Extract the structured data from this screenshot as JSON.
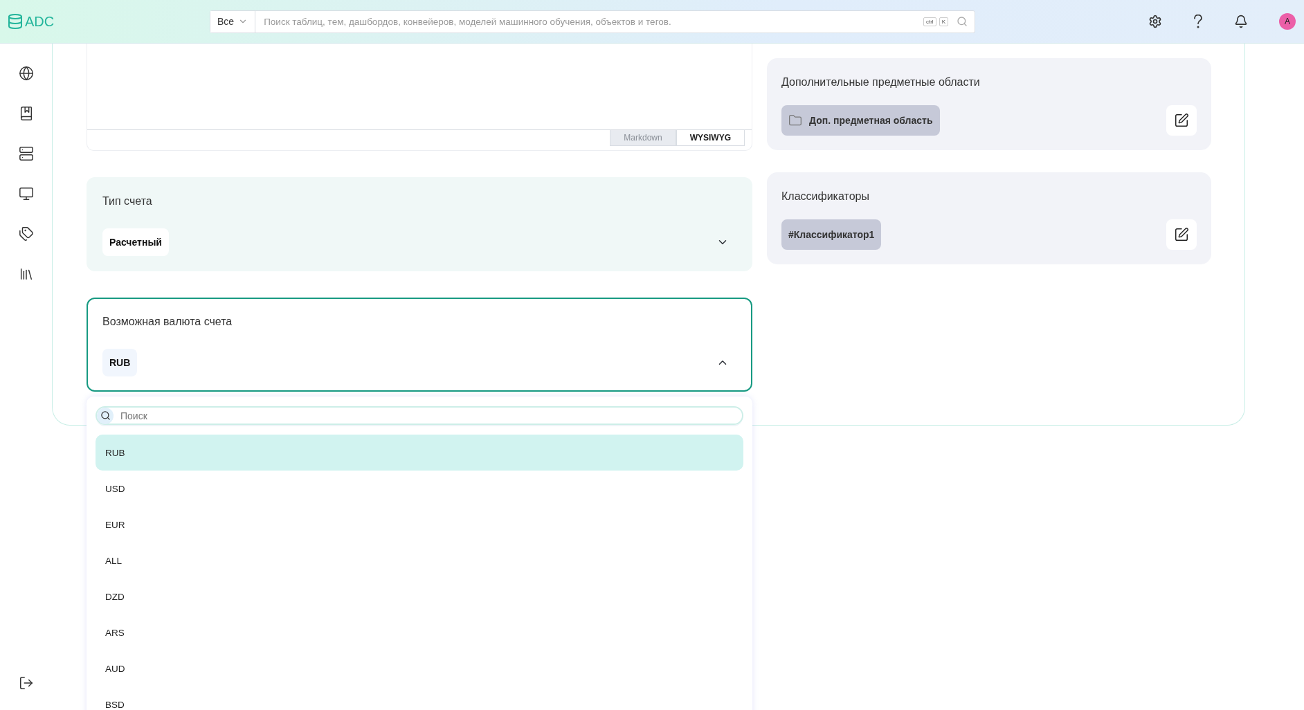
{
  "header": {
    "logo": "ADC",
    "search": {
      "scope": "Все",
      "placeholder": "Поиск таблиц, тем, дашбордов, конвейеров, моделей машинного обучения, объектов и тегов.",
      "shortcut": [
        "ctrl",
        "K"
      ]
    },
    "avatar": "A"
  },
  "editor": {
    "tabs": [
      {
        "label": "Markdown",
        "selected": false
      },
      {
        "label": "WYSIWYG",
        "selected": true
      }
    ]
  },
  "fields": [
    {
      "label": "Тип счета",
      "value": "Расчетный",
      "expanded": false
    },
    {
      "label": "Возможная валюта счета",
      "value": "RUB",
      "expanded": true
    }
  ],
  "dropdown": {
    "placeholder": "Поиск",
    "options": [
      {
        "label": "RUB",
        "selected": true
      },
      {
        "label": "USD",
        "selected": false
      },
      {
        "label": "EUR",
        "selected": false
      },
      {
        "label": "ALL",
        "selected": false
      },
      {
        "label": "DZD",
        "selected": false
      },
      {
        "label": "ARS",
        "selected": false
      },
      {
        "label": "AUD",
        "selected": false
      },
      {
        "label": "BSD",
        "selected": false
      }
    ]
  },
  "side_panels": [
    {
      "title": "Дополнительные предметные области",
      "chips": [
        {
          "label": "Доп. предметная область",
          "kind": "folder"
        }
      ]
    },
    {
      "title": "Классификаторы",
      "chips": [
        {
          "label": "#Классификатор1",
          "kind": "plain"
        }
      ]
    }
  ]
}
